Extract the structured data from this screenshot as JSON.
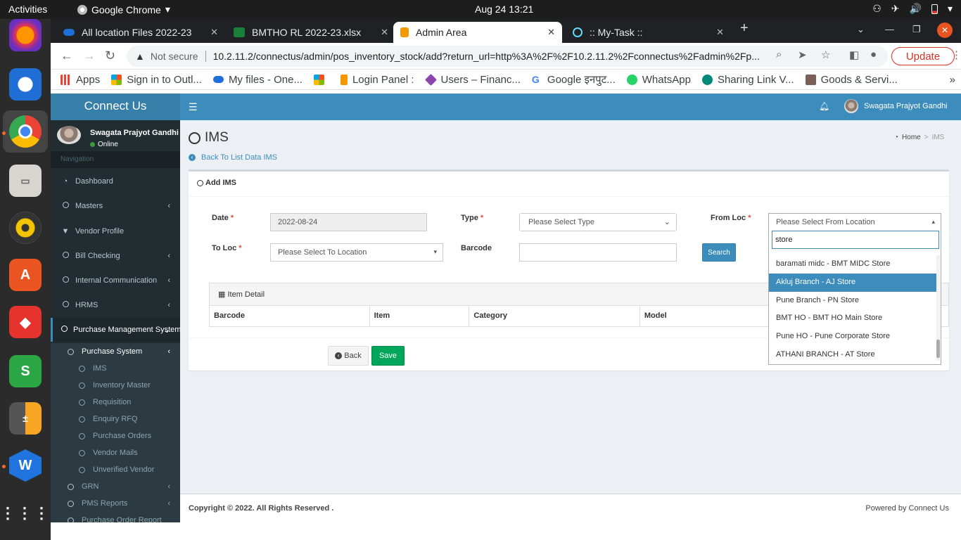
{
  "topbar": {
    "activities": "Activities",
    "app_name": "Google Chrome",
    "clock": "Aug 24  13:21"
  },
  "tabs": [
    {
      "label": "All location Files 2022-23",
      "icon_color": "#1e6fd9"
    },
    {
      "label": "BMTHO RL 2022-23.xlsx",
      "icon_color": "#188038"
    },
    {
      "label": "Admin Area",
      "icon_color": "#f29900"
    },
    {
      "label": ":: My-Task ::",
      "icon_color": "#61dafb"
    }
  ],
  "toolbar": {
    "not_secure": "Not secure",
    "url": "10.2.11.2/connectus/admin/pos_inventory_stock/add?return_url=http%3A%2F%2F10.2.11.2%2Fconnectus%2Fadmin%2Fp...",
    "update_label": "Update"
  },
  "bookmarks": [
    {
      "label": "Apps",
      "color": "#ea4335"
    },
    {
      "label": "Sign in to Outl...",
      "color": "#f25022"
    },
    {
      "label": "My files - One...",
      "color": "#1e6fd9"
    },
    {
      "label": "",
      "color": "#7fba00"
    },
    {
      "label": "Login Panel :",
      "color": "#f29900"
    },
    {
      "label": "Users – Financ...",
      "color": "#8e44ad"
    },
    {
      "label": "Google इनपुट...",
      "color": "#4285f4"
    },
    {
      "label": "WhatsApp",
      "color": "#25d366"
    },
    {
      "label": "Sharing Link V...",
      "color": "#00897b"
    },
    {
      "label": "Goods & Servi...",
      "color": "#7b5e57"
    }
  ],
  "app": {
    "logo": "Connect Us",
    "user": {
      "name": "Swagata Prajyot Gandhi",
      "status": "Online"
    },
    "nav_header": "Navigation",
    "menu": [
      {
        "label": "Dashboard",
        "icon": "dashboard-icon"
      },
      {
        "label": "Masters",
        "icon": "circle-icon"
      },
      {
        "label": "Vendor Profile",
        "icon": "filter-icon"
      },
      {
        "label": "Bill Checking",
        "icon": "circle-icon"
      },
      {
        "label": "Internal Communication",
        "icon": "circle-icon"
      },
      {
        "label": "HRMS",
        "icon": "circle-icon"
      },
      {
        "label": "Purchase Management System",
        "icon": "circle-icon"
      }
    ],
    "submenu": [
      {
        "label": "Purchase System"
      },
      {
        "label": "IMS"
      },
      {
        "label": "Inventory Master"
      },
      {
        "label": "Requisition"
      },
      {
        "label": "Enquiry RFQ"
      },
      {
        "label": "Purchase Orders"
      },
      {
        "label": "Vendor Mails"
      },
      {
        "label": "Unverified Vendor"
      },
      {
        "label": "GRN"
      },
      {
        "label": "PMS Reports"
      },
      {
        "label": "Purchase Order Report"
      }
    ],
    "header_user": "Swagata Prajyot Gandhi",
    "page_title": "IMS",
    "breadcrumb": {
      "home": "Home",
      "sep": ">",
      "current": "IMS"
    },
    "back_link": "Back To List Data IMS",
    "box_title": "Add IMS",
    "form": {
      "date_label": "Date",
      "date_value": "2022-08-24",
      "type_label": "Type",
      "type_value": "Please Select Type",
      "fromloc_label": "From Loc",
      "fromloc_value": "Please Select From Location",
      "toloc_label": "To Loc",
      "toloc_value": "Please Select To Location",
      "barcode_label": "Barcode",
      "barcode_value": "",
      "search_label": "Search",
      "required_mark": "*"
    },
    "item_detail": {
      "title": "Item Detail",
      "columns": [
        "Barcode",
        "Item",
        "Category",
        "Model"
      ]
    },
    "buttons": {
      "back": "Back",
      "save": "Save"
    },
    "dropdown": {
      "search_value": "store",
      "options": [
        "baramati midc - BMT MIDC Store",
        "Akluj Branch - AJ Store",
        "Pune Branch - PN Store",
        "BMT HO - BMT HO Main Store",
        "Pune HO - Pune Corporate Store",
        "ATHANI BRANCH - AT Store"
      ],
      "highlighted_index": 1
    },
    "footer": {
      "copyright": "Copyright © 2022. All Rights Reserved .",
      "powered": "Powered by Connect Us"
    }
  }
}
